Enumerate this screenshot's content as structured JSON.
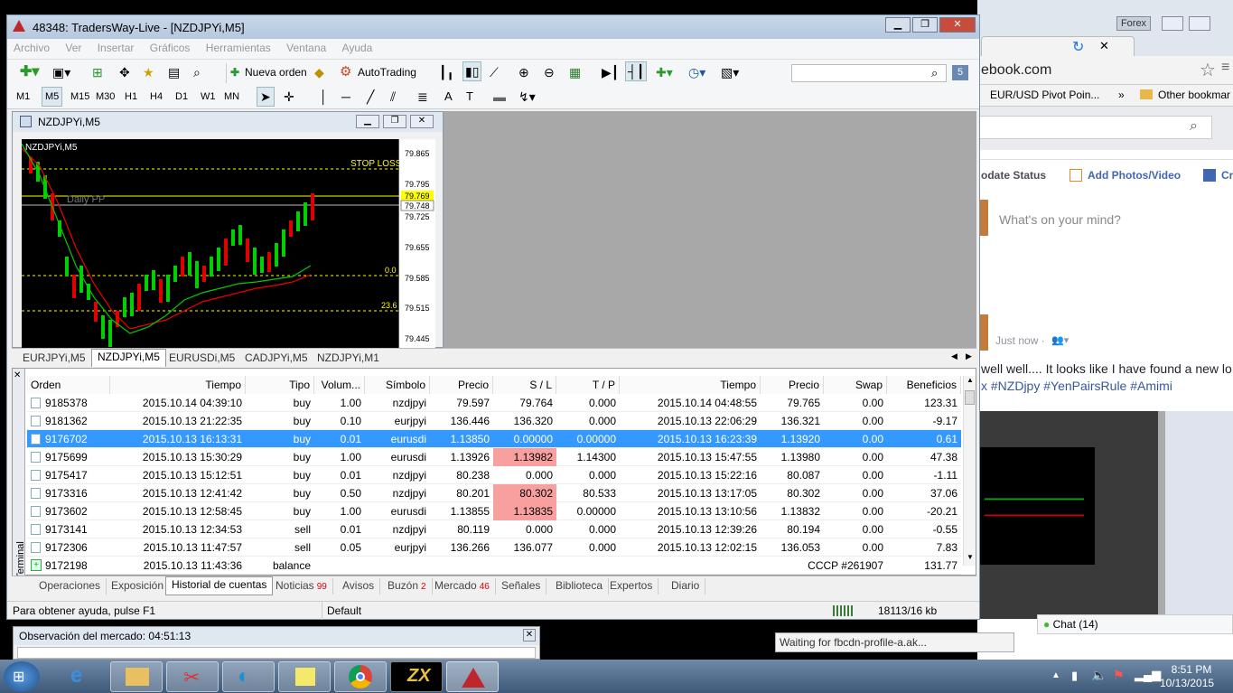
{
  "browser": {
    "tab_label": "Forex",
    "url": "ebook.com",
    "bookmarks": [
      "EUR/USD Pivot Poin...",
      "»",
      "Other bookmar"
    ],
    "status_tabs": [
      "odate Status",
      "Add Photos/Video",
      "Cr"
    ],
    "composer_placeholder": "What's on your mind?",
    "post_time": "Just now ·",
    "post_text_1": "well well.... It looks like I have found a new lo",
    "post_text_2": "x #NZDjpy #YenPairsRule #Amimi",
    "loading_status": "Waiting for fbcdn-profile-a.ak...",
    "chat_label": "Chat (14)"
  },
  "mt4": {
    "title": "48348: TradersWay-Live - [NZDJPYi,M5]",
    "menu": [
      "Archivo",
      "Ver",
      "Insertar",
      "Gráficos",
      "Herramientas",
      "Ventana",
      "Ayuda"
    ],
    "toolbar": {
      "new_order": "Nueva orden",
      "autotrading": "AutoTrading"
    },
    "timeframes": [
      "M1",
      "M5",
      "M15",
      "M30",
      "H1",
      "H4",
      "D1",
      "W1",
      "MN"
    ],
    "search_badge": "5",
    "chart_window_title": "NZDJPYi,M5",
    "chart": {
      "label": "NZDJPYi,M5",
      "stop_loss_label": "STOP LOSS",
      "daily_pp_label": "Daily PP",
      "level_00": "0.0",
      "level_236": "23.6",
      "prices": [
        "79.865",
        "79.795",
        "79.769",
        "79.748",
        "79.725",
        "79.655",
        "79.585",
        "79.515",
        "79.445"
      ]
    },
    "chart_tabs": [
      "EURJPYi,M5",
      "NZDJPYi,M5",
      "EURUSDi,M5",
      "CADJPYi,M5",
      "NZDJPYi,M1"
    ],
    "terminal": {
      "side_label": "Terminal",
      "columns": [
        "Orden",
        "Tiempo",
        "Tipo",
        "Volum...",
        "Símbolo",
        "Precio",
        "S / L",
        "T / P",
        "Tiempo",
        "Precio",
        "Swap",
        "Beneficios"
      ],
      "rows": [
        [
          "9185378",
          "2015.10.14 04:39:10",
          "buy",
          "1.00",
          "nzdjpyi",
          "79.597",
          "79.764",
          "0.000",
          "2015.10.14 04:48:55",
          "79.765",
          "0.00",
          "123.31"
        ],
        [
          "9181362",
          "2015.10.13 21:22:35",
          "buy",
          "0.10",
          "eurjpyi",
          "136.446",
          "136.320",
          "0.000",
          "2015.10.13 22:06:29",
          "136.321",
          "0.00",
          "-9.17"
        ],
        [
          "9176702",
          "2015.10.13 16:13:31",
          "buy",
          "0.01",
          "eurusdi",
          "1.13850",
          "0.00000",
          "0.00000",
          "2015.10.13 16:23:39",
          "1.13920",
          "0.00",
          "0.61"
        ],
        [
          "9175699",
          "2015.10.13 15:30:29",
          "buy",
          "1.00",
          "eurusdi",
          "1.13926",
          "1.13982",
          "1.14300",
          "2015.10.13 15:47:55",
          "1.13980",
          "0.00",
          "47.38"
        ],
        [
          "9175417",
          "2015.10.13 15:12:51",
          "buy",
          "0.01",
          "nzdjpyi",
          "80.238",
          "0.000",
          "0.000",
          "2015.10.13 15:22:16",
          "80.087",
          "0.00",
          "-1.11"
        ],
        [
          "9173316",
          "2015.10.13 12:41:42",
          "buy",
          "0.50",
          "nzdjpyi",
          "80.201",
          "80.302",
          "80.533",
          "2015.10.13 13:17:05",
          "80.302",
          "0.00",
          "37.06"
        ],
        [
          "9173602",
          "2015.10.13 12:58:45",
          "buy",
          "1.00",
          "eurusdi",
          "1.13855",
          "1.13835",
          "0.00000",
          "2015.10.13 13:10:56",
          "1.13832",
          "0.00",
          "-20.21"
        ],
        [
          "9173141",
          "2015.10.13 12:34:53",
          "sell",
          "0.01",
          "nzdjpyi",
          "80.119",
          "0.000",
          "0.000",
          "2015.10.13 12:39:26",
          "80.194",
          "0.00",
          "-0.55"
        ],
        [
          "9172306",
          "2015.10.13 11:47:57",
          "sell",
          "0.05",
          "eurjpyi",
          "136.266",
          "136.077",
          "0.000",
          "2015.10.13 12:02:15",
          "136.053",
          "0.00",
          "7.83"
        ]
      ],
      "balance_row": {
        "order": "9172198",
        "time": "2015.10.13 11:43:36",
        "type": "balance",
        "comment": "CCCP #261907",
        "amount": "131.77"
      },
      "tabs": [
        "Operaciones",
        "Exposición",
        "Historial de cuentas",
        "Noticias",
        "Avisos",
        "Buzón",
        "Mercado",
        "Señales",
        "Biblioteca",
        "Expertos",
        "Diario"
      ],
      "badges": {
        "noticias": "99",
        "buzon": "2",
        "mercado": "46"
      }
    },
    "status": {
      "help": "Para obtener ayuda, pulse F1",
      "profile": "Default",
      "traffic": "18113/16 kb"
    },
    "market_watch_title": "Observación del mercado: 04:51:13"
  },
  "taskbar": {
    "time": "8:51 PM",
    "date": "10/13/2015"
  }
}
